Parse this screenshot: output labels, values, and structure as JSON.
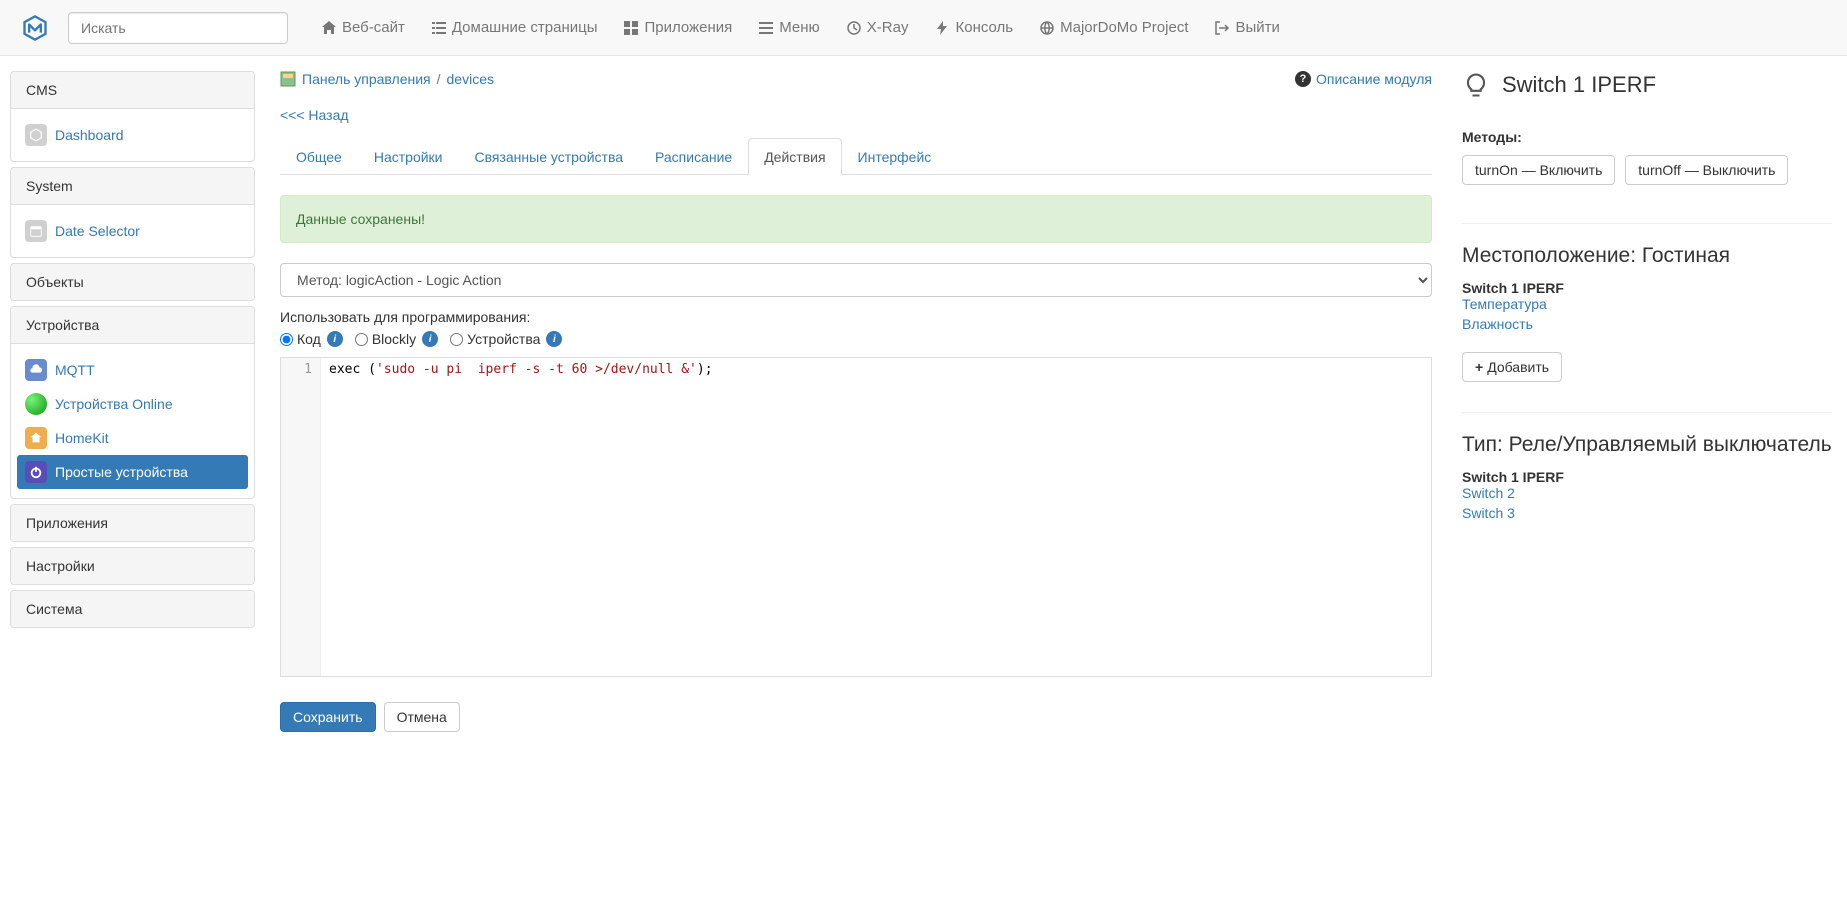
{
  "navbar": {
    "search_placeholder": "Искать",
    "items": [
      {
        "label": "Веб-сайт"
      },
      {
        "label": "Домашние страницы"
      },
      {
        "label": "Приложения"
      },
      {
        "label": "Меню"
      },
      {
        "label": "X-Ray"
      },
      {
        "label": "Консоль"
      },
      {
        "label": "MajorDoMo Project"
      },
      {
        "label": "Выйти"
      }
    ]
  },
  "sidebar": {
    "cms": {
      "title": "CMS",
      "dashboard": "Dashboard"
    },
    "system": {
      "title": "System",
      "date_selector": "Date Selector"
    },
    "objects": {
      "title": "Объекты"
    },
    "devices": {
      "title": "Устройства",
      "items": {
        "mqtt": "MQTT",
        "online": "Устройства Online",
        "homekit": "HomeKit",
        "simple": "Простые устройства"
      }
    },
    "apps": {
      "title": "Приложения"
    },
    "settings": {
      "title": "Настройки"
    },
    "system2": {
      "title": "Система"
    }
  },
  "crumb": {
    "panel": "Панель управления",
    "devices": "devices",
    "help": "Описание модуля"
  },
  "back": "<<< Назад",
  "tabs": {
    "general": "Общее",
    "settings": "Настройки",
    "linked": "Связанные устройства",
    "schedule": "Расписание",
    "actions": "Действия",
    "interface": "Интерфейс"
  },
  "alert": "Данные сохранены!",
  "method_select": "Метод: logicAction - Logic Action",
  "prog_label": "Использовать для программирования:",
  "radios": {
    "code": "Код",
    "blockly": "Blockly",
    "devices": "Устройства"
  },
  "code": {
    "line1_fn": "exec ",
    "line1_open": "(",
    "line1_str": "'sudo -u pi  iperf -s -t 60 >/dev/null &'",
    "line1_close": ");"
  },
  "buttons": {
    "save": "Сохранить",
    "cancel": "Отмена"
  },
  "side": {
    "title": "Switch 1 IPERF",
    "methods_label": "Методы:",
    "methods": {
      "on": "turnOn — Включить",
      "off": "turnOff — Выключить"
    },
    "loc_title": "Местоположение: Гостиная",
    "loc_items": {
      "current": "Switch 1 IPERF",
      "temp": "Температура",
      "humidity": "Влажность"
    },
    "add": "Добавить",
    "type_title": "Тип: Реле/Управляемый выключатель",
    "type_items": {
      "current": "Switch 1 IPERF",
      "s2": "Switch 2",
      "s3": "Switch 3"
    }
  }
}
